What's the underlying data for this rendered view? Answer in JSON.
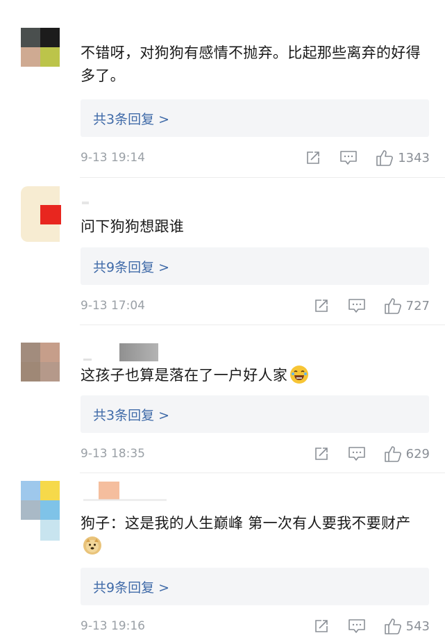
{
  "comments": [
    {
      "content": "不错呀，对狗狗有感情不抛弃。比起那些离弃的好得多了。",
      "replies_label": "共3条回复 >",
      "time": "9-13 19:14",
      "likes": "1343",
      "avatar_colors": [
        "#4a4f4e",
        "#1c1c1c",
        "#cfaa92",
        "#bcc44a"
      ]
    },
    {
      "content": "问下狗狗想跟谁",
      "replies_label": "共9条回复 >",
      "time": "9-13 17:04",
      "likes": "727",
      "avatar_colors": [
        "#f7ecd2",
        "#e8261f"
      ]
    },
    {
      "content": "这孩子也算是落在了一户好人家",
      "replies_label": "共3条回复 >",
      "time": "9-13 18:35",
      "likes": "629",
      "avatar_colors": [
        "#a28c7d",
        "#c69e8a",
        "#9f8876",
        "#b5998a"
      ]
    },
    {
      "content": "狗子：这是我的人生巅峰 第一次有人要我不要财产",
      "replies_label": "共9条回复 >",
      "time": "9-13 19:16",
      "likes": "543",
      "avatar_colors": [
        "#9ec8ec",
        "#f6d94a",
        "#a9b9c6",
        "#7fc3e8",
        "#c8e4ef"
      ]
    }
  ],
  "icons": {
    "share": "share-icon",
    "comment": "comment-icon",
    "like": "thumbs-up-icon"
  }
}
